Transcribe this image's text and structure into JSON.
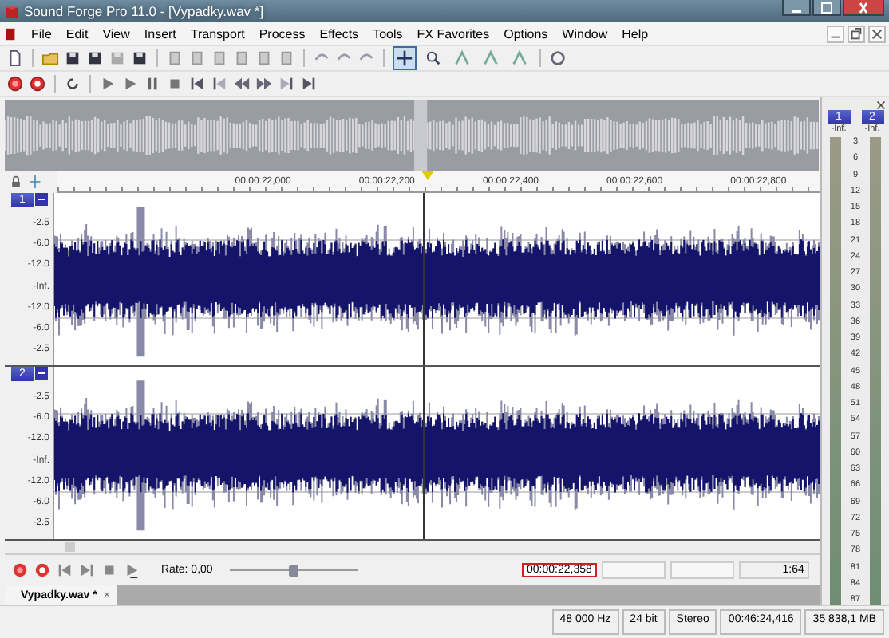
{
  "window": {
    "title": "Sound Forge Pro 11.0 - [Vypadky.wav *]"
  },
  "menu": [
    "File",
    "Edit",
    "View",
    "Insert",
    "Transport",
    "Process",
    "Effects",
    "Tools",
    "FX Favorites",
    "Options",
    "Window",
    "Help"
  ],
  "tools": [
    {
      "selected": true
    },
    {
      "selected": false
    },
    {
      "selected": false
    },
    {
      "selected": false
    },
    {
      "selected": false
    }
  ],
  "ruler": [
    "00:00:22,000",
    "00:00:22,200",
    "00:00:22,400",
    "00:00:22,600",
    "00:00:22,800"
  ],
  "channels": [
    {
      "number": "1",
      "scale": [
        "-2.5",
        "-6.0",
        "-12.0",
        "-Inf.",
        "-12.0",
        "-6.0",
        "-2.5"
      ]
    },
    {
      "number": "2",
      "scale": [
        "-2.5",
        "-6.0",
        "-12.0",
        "-Inf.",
        "-12.0",
        "-6.0",
        "-2.5"
      ]
    }
  ],
  "meter": {
    "channels": [
      {
        "number": "1",
        "peak": "-Inf."
      },
      {
        "number": "2",
        "peak": "-Inf."
      }
    ],
    "scale": [
      "3",
      "6",
      "9",
      "12",
      "15",
      "18",
      "21",
      "24",
      "27",
      "30",
      "33",
      "36",
      "39",
      "42",
      "45",
      "48",
      "51",
      "54",
      "57",
      "60",
      "63",
      "66",
      "69",
      "72",
      "75",
      "78",
      "81",
      "84",
      "87"
    ]
  },
  "transport": {
    "rate": "Rate: 0,00",
    "rate_slider": {
      "level": 0.5
    },
    "position": "00:00:22,358",
    "zoom": "1:64"
  },
  "tabs": [
    {
      "label": "Vypadky.wav *",
      "close": "×",
      "selected": true
    }
  ],
  "status_bar": [
    "48 000 Hz",
    "24 bit",
    "Stereo",
    "00:46:24,416",
    "35 838,1 MB"
  ]
}
